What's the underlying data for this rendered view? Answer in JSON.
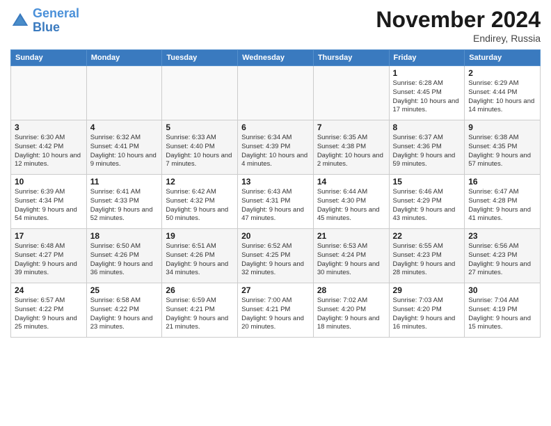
{
  "logo": {
    "line1": "General",
    "line2": "Blue"
  },
  "title": "November 2024",
  "subtitle": "Endirey, Russia",
  "days_header": [
    "Sunday",
    "Monday",
    "Tuesday",
    "Wednesday",
    "Thursday",
    "Friday",
    "Saturday"
  ],
  "weeks": [
    [
      {
        "day": "",
        "info": ""
      },
      {
        "day": "",
        "info": ""
      },
      {
        "day": "",
        "info": ""
      },
      {
        "day": "",
        "info": ""
      },
      {
        "day": "",
        "info": ""
      },
      {
        "day": "1",
        "info": "Sunrise: 6:28 AM\nSunset: 4:45 PM\nDaylight: 10 hours and 17 minutes."
      },
      {
        "day": "2",
        "info": "Sunrise: 6:29 AM\nSunset: 4:44 PM\nDaylight: 10 hours and 14 minutes."
      }
    ],
    [
      {
        "day": "3",
        "info": "Sunrise: 6:30 AM\nSunset: 4:42 PM\nDaylight: 10 hours and 12 minutes."
      },
      {
        "day": "4",
        "info": "Sunrise: 6:32 AM\nSunset: 4:41 PM\nDaylight: 10 hours and 9 minutes."
      },
      {
        "day": "5",
        "info": "Sunrise: 6:33 AM\nSunset: 4:40 PM\nDaylight: 10 hours and 7 minutes."
      },
      {
        "day": "6",
        "info": "Sunrise: 6:34 AM\nSunset: 4:39 PM\nDaylight: 10 hours and 4 minutes."
      },
      {
        "day": "7",
        "info": "Sunrise: 6:35 AM\nSunset: 4:38 PM\nDaylight: 10 hours and 2 minutes."
      },
      {
        "day": "8",
        "info": "Sunrise: 6:37 AM\nSunset: 4:36 PM\nDaylight: 9 hours and 59 minutes."
      },
      {
        "day": "9",
        "info": "Sunrise: 6:38 AM\nSunset: 4:35 PM\nDaylight: 9 hours and 57 minutes."
      }
    ],
    [
      {
        "day": "10",
        "info": "Sunrise: 6:39 AM\nSunset: 4:34 PM\nDaylight: 9 hours and 54 minutes."
      },
      {
        "day": "11",
        "info": "Sunrise: 6:41 AM\nSunset: 4:33 PM\nDaylight: 9 hours and 52 minutes."
      },
      {
        "day": "12",
        "info": "Sunrise: 6:42 AM\nSunset: 4:32 PM\nDaylight: 9 hours and 50 minutes."
      },
      {
        "day": "13",
        "info": "Sunrise: 6:43 AM\nSunset: 4:31 PM\nDaylight: 9 hours and 47 minutes."
      },
      {
        "day": "14",
        "info": "Sunrise: 6:44 AM\nSunset: 4:30 PM\nDaylight: 9 hours and 45 minutes."
      },
      {
        "day": "15",
        "info": "Sunrise: 6:46 AM\nSunset: 4:29 PM\nDaylight: 9 hours and 43 minutes."
      },
      {
        "day": "16",
        "info": "Sunrise: 6:47 AM\nSunset: 4:28 PM\nDaylight: 9 hours and 41 minutes."
      }
    ],
    [
      {
        "day": "17",
        "info": "Sunrise: 6:48 AM\nSunset: 4:27 PM\nDaylight: 9 hours and 39 minutes."
      },
      {
        "day": "18",
        "info": "Sunrise: 6:50 AM\nSunset: 4:26 PM\nDaylight: 9 hours and 36 minutes."
      },
      {
        "day": "19",
        "info": "Sunrise: 6:51 AM\nSunset: 4:26 PM\nDaylight: 9 hours and 34 minutes."
      },
      {
        "day": "20",
        "info": "Sunrise: 6:52 AM\nSunset: 4:25 PM\nDaylight: 9 hours and 32 minutes."
      },
      {
        "day": "21",
        "info": "Sunrise: 6:53 AM\nSunset: 4:24 PM\nDaylight: 9 hours and 30 minutes."
      },
      {
        "day": "22",
        "info": "Sunrise: 6:55 AM\nSunset: 4:23 PM\nDaylight: 9 hours and 28 minutes."
      },
      {
        "day": "23",
        "info": "Sunrise: 6:56 AM\nSunset: 4:23 PM\nDaylight: 9 hours and 27 minutes."
      }
    ],
    [
      {
        "day": "24",
        "info": "Sunrise: 6:57 AM\nSunset: 4:22 PM\nDaylight: 9 hours and 25 minutes."
      },
      {
        "day": "25",
        "info": "Sunrise: 6:58 AM\nSunset: 4:22 PM\nDaylight: 9 hours and 23 minutes."
      },
      {
        "day": "26",
        "info": "Sunrise: 6:59 AM\nSunset: 4:21 PM\nDaylight: 9 hours and 21 minutes."
      },
      {
        "day": "27",
        "info": "Sunrise: 7:00 AM\nSunset: 4:21 PM\nDaylight: 9 hours and 20 minutes."
      },
      {
        "day": "28",
        "info": "Sunrise: 7:02 AM\nSunset: 4:20 PM\nDaylight: 9 hours and 18 minutes."
      },
      {
        "day": "29",
        "info": "Sunrise: 7:03 AM\nSunset: 4:20 PM\nDaylight: 9 hours and 16 minutes."
      },
      {
        "day": "30",
        "info": "Sunrise: 7:04 AM\nSunset: 4:19 PM\nDaylight: 9 hours and 15 minutes."
      }
    ]
  ]
}
